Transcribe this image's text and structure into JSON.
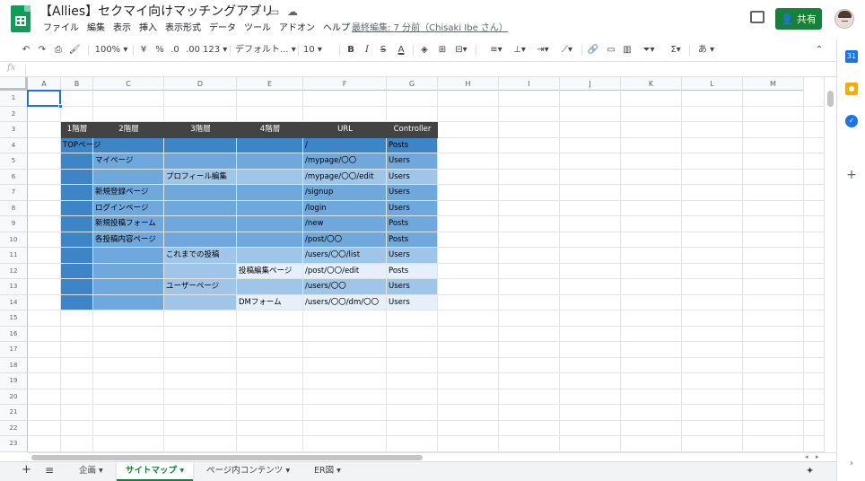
{
  "header": {
    "title": "【Allies】セクマイ向けマッチングアプリ",
    "share_label": "共有",
    "last_edit": "最終編集: 7 分前（Chisaki Ibe さん）",
    "menus": [
      "ファイル",
      "編集",
      "表示",
      "挿入",
      "表示形式",
      "データ",
      "ツール",
      "アドオン",
      "ヘルプ"
    ]
  },
  "toolbar": {
    "zoom": "100%",
    "currency": "¥",
    "percent": "%",
    "dec_less": ".0",
    "dec_more": ".00",
    "format_more": "123",
    "font": "デフォルト...",
    "font_size": "10",
    "bold": "B",
    "italic": "I",
    "strike": "S",
    "text_color": "A",
    "input_tools": "あ"
  },
  "formula": {
    "fx": "fx",
    "value": ""
  },
  "columns": [
    "A",
    "B",
    "C",
    "D",
    "E",
    "F",
    "G",
    "H",
    "I",
    "J",
    "K",
    "L",
    "M"
  ],
  "rows": [
    "1",
    "2",
    "3",
    "4",
    "5",
    "6",
    "7",
    "8",
    "9",
    "10",
    "11",
    "12",
    "13",
    "14",
    "15",
    "16",
    "17",
    "18",
    "19",
    "20",
    "21",
    "22",
    "23"
  ],
  "table": {
    "headers": [
      "1階層",
      "2階層",
      "3階層",
      "4階層",
      "URL",
      "Controller"
    ],
    "cells": [
      {
        "row": 4,
        "col": "B",
        "text": "TOPページ"
      },
      {
        "row": 4,
        "col": "F",
        "text": "/"
      },
      {
        "row": 4,
        "col": "G",
        "text": "Posts"
      },
      {
        "row": 5,
        "col": "C",
        "text": "マイページ"
      },
      {
        "row": 5,
        "col": "F",
        "text": "/mypage/〇〇"
      },
      {
        "row": 5,
        "col": "G",
        "text": "Users"
      },
      {
        "row": 6,
        "col": "D",
        "text": "プロフィール編集"
      },
      {
        "row": 6,
        "col": "F",
        "text": "/mypage/〇〇/edit"
      },
      {
        "row": 6,
        "col": "G",
        "text": "Users"
      },
      {
        "row": 7,
        "col": "C",
        "text": "新規登録ページ"
      },
      {
        "row": 7,
        "col": "F",
        "text": "/signup"
      },
      {
        "row": 7,
        "col": "G",
        "text": "Users"
      },
      {
        "row": 8,
        "col": "C",
        "text": "ログインページ"
      },
      {
        "row": 8,
        "col": "F",
        "text": "/login"
      },
      {
        "row": 8,
        "col": "G",
        "text": "Users"
      },
      {
        "row": 9,
        "col": "C",
        "text": "新規投稿フォーム"
      },
      {
        "row": 9,
        "col": "F",
        "text": "/new"
      },
      {
        "row": 9,
        "col": "G",
        "text": "Posts"
      },
      {
        "row": 10,
        "col": "C",
        "text": "各投稿内容ページ"
      },
      {
        "row": 10,
        "col": "F",
        "text": "/post/〇〇"
      },
      {
        "row": 10,
        "col": "G",
        "text": "Posts"
      },
      {
        "row": 11,
        "col": "D",
        "text": "これまでの投稿"
      },
      {
        "row": 11,
        "col": "F",
        "text": "/users/〇〇/list"
      },
      {
        "row": 11,
        "col": "G",
        "text": "Users"
      },
      {
        "row": 12,
        "col": "E",
        "text": "投稿編集ページ"
      },
      {
        "row": 12,
        "col": "F",
        "text": "/post/〇〇/edit"
      },
      {
        "row": 12,
        "col": "G",
        "text": "Posts"
      },
      {
        "row": 13,
        "col": "D",
        "text": "ユーザーページ"
      },
      {
        "row": 13,
        "col": "F",
        "text": "/users/〇〇"
      },
      {
        "row": 13,
        "col": "G",
        "text": "Users"
      },
      {
        "row": 14,
        "col": "E",
        "text": "DMフォーム"
      },
      {
        "row": 14,
        "col": "F",
        "text": "/users/〇〇/dm/〇〇"
      },
      {
        "row": 14,
        "col": "G",
        "text": "Users"
      }
    ]
  },
  "colors": {
    "header_bg": "#434343",
    "level1": "#3d85c6",
    "level2": "#6fa8dc",
    "level3": "#9fc5e8",
    "level4": "#cfe2f3",
    "light": "#e6f0fa",
    "accent": "#188038"
  },
  "tabs": [
    {
      "label": "企画"
    },
    {
      "label": "サイトマップ"
    },
    {
      "label": "ページ内コンテンツ"
    },
    {
      "label": "ER図"
    }
  ]
}
